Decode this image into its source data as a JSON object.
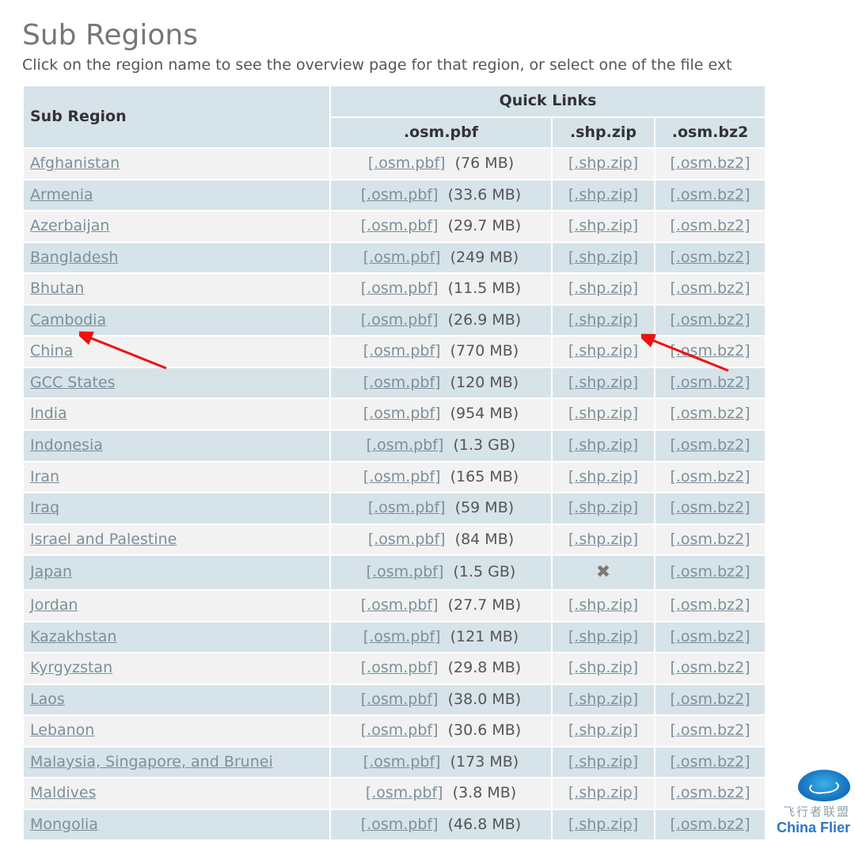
{
  "heading": "Sub Regions",
  "subtitle": "Click on the region name to see the overview page for that region, or select one of the file ext",
  "columns": {
    "sub_region": "Sub Region",
    "quick_links": "Quick Links",
    "pbf": ".osm.pbf",
    "shp": ".shp.zip",
    "bz2": ".osm.bz2"
  },
  "link_text": {
    "pbf": "[.osm.pbf]",
    "shp": "[.shp.zip]",
    "bz2": "[.osm.bz2]"
  },
  "unavailable_icon": "✖",
  "rows": [
    {
      "name": "Afghanistan",
      "size": "(76 MB)",
      "shp": true
    },
    {
      "name": "Armenia",
      "size": "(33.6 MB)",
      "shp": true
    },
    {
      "name": "Azerbaijan",
      "size": "(29.7 MB)",
      "shp": true
    },
    {
      "name": "Bangladesh",
      "size": "(249 MB)",
      "shp": true
    },
    {
      "name": "Bhutan",
      "size": "(11.5 MB)",
      "shp": true
    },
    {
      "name": "Cambodia",
      "size": "(26.9 MB)",
      "shp": true
    },
    {
      "name": "China",
      "size": "(770 MB)",
      "shp": true
    },
    {
      "name": "GCC States",
      "size": "(120 MB)",
      "shp": true
    },
    {
      "name": "India",
      "size": "(954 MB)",
      "shp": true
    },
    {
      "name": "Indonesia",
      "size": "(1.3 GB)",
      "shp": true
    },
    {
      "name": "Iran",
      "size": "(165 MB)",
      "shp": true
    },
    {
      "name": "Iraq",
      "size": "(59 MB)",
      "shp": true
    },
    {
      "name": "Israel and Palestine",
      "size": "(84 MB)",
      "shp": true
    },
    {
      "name": "Japan",
      "size": "(1.5 GB)",
      "shp": false
    },
    {
      "name": "Jordan",
      "size": "(27.7 MB)",
      "shp": true
    },
    {
      "name": "Kazakhstan",
      "size": "(121 MB)",
      "shp": true
    },
    {
      "name": "Kyrgyzstan",
      "size": "(29.8 MB)",
      "shp": true
    },
    {
      "name": "Laos",
      "size": "(38.0 MB)",
      "shp": true
    },
    {
      "name": "Lebanon",
      "size": "(30.6 MB)",
      "shp": true
    },
    {
      "name": "Malaysia, Singapore, and Brunei",
      "size": "(173 MB)",
      "shp": true
    },
    {
      "name": "Maldives",
      "size": "(3.8 MB)",
      "shp": true
    },
    {
      "name": "Mongolia",
      "size": "(46.8 MB)",
      "shp": true
    }
  ],
  "badge": {
    "cn": "飞行者联盟",
    "en": "China Flier"
  }
}
